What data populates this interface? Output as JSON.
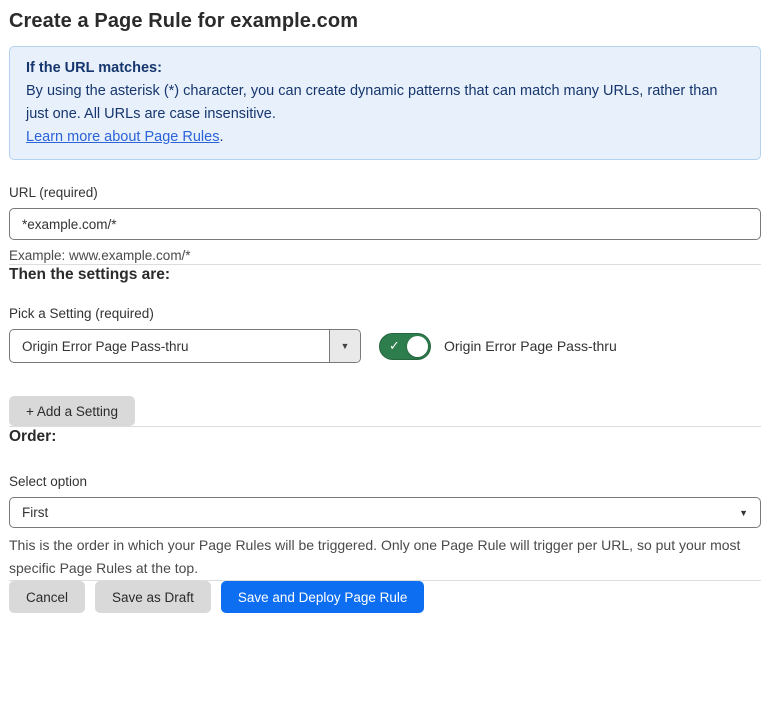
{
  "page": {
    "title": "Create a Page Rule for example.com"
  },
  "info_box": {
    "heading": "If the URL matches:",
    "body": "By using the asterisk (*) character, you can create dynamic patterns that can match many URLs, rather than just one. All URLs are case insensitive.",
    "link_label": "Learn more about Page Rules",
    "link_suffix": "."
  },
  "url_field": {
    "label": "URL (required)",
    "value": "*example.com/*",
    "helper": "Example: www.example.com/*"
  },
  "settings_section": {
    "heading": "Then the settings are:",
    "pick_label": "Pick a Setting (required)",
    "selected_setting": "Origin Error Page Pass-thru",
    "toggle_label": "Origin Error Page Pass-thru",
    "toggle_state": "on",
    "add_setting_label": "+ Add a Setting"
  },
  "order_section": {
    "heading": "Order:",
    "select_label": "Select option",
    "selected_option": "First",
    "helper": "This is the order in which your Page Rules will be triggered. Only one Page Rule will trigger per URL, so put your most specific Page Rules at the top."
  },
  "actions": {
    "cancel_label": "Cancel",
    "save_draft_label": "Save as Draft",
    "save_deploy_label": "Save and Deploy Page Rule"
  },
  "icons": {
    "dropdown_arrow": "▼",
    "select_arrow": "▼",
    "toggle_check": "✓"
  },
  "colors": {
    "info_bg": "#e8f1fb",
    "info_border": "#b3d2f0",
    "info_text": "#16366d",
    "link": "#2c63d9",
    "toggle_on_green": "#2e7d4c",
    "primary_button_blue": "#0d6ef2",
    "secondary_button_gray": "#d9d9d9",
    "input_border_gray": "#797979",
    "divider_gray": "#dddddd"
  }
}
